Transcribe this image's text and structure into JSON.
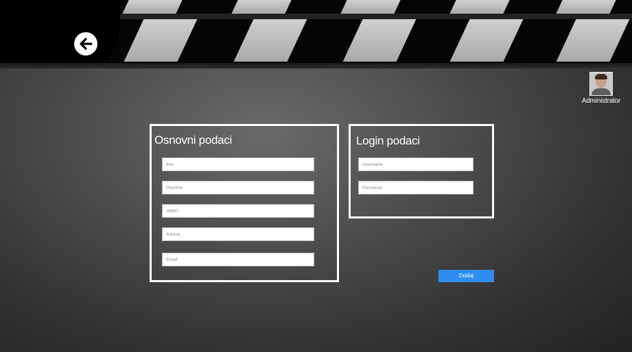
{
  "header": {
    "back_icon": "arrow-left-icon"
  },
  "user": {
    "name": "Administrator",
    "avatar_icon": "user-avatar"
  },
  "basic_panel": {
    "title": "Osnovni podaci",
    "fields": [
      {
        "placeholder": "Ime",
        "value": ""
      },
      {
        "placeholder": "Prezime",
        "value": ""
      },
      {
        "placeholder": "JMBG",
        "value": ""
      },
      {
        "placeholder": "Adresa",
        "value": ""
      },
      {
        "placeholder": "Email",
        "value": ""
      }
    ]
  },
  "login_panel": {
    "title": "Login podaci",
    "fields": [
      {
        "placeholder": "Username",
        "value": ""
      },
      {
        "placeholder": "Password",
        "value": ""
      }
    ]
  },
  "submit_label": "Dodaj",
  "colors": {
    "accent": "#2f8def",
    "panel_border": "#ffffff"
  }
}
